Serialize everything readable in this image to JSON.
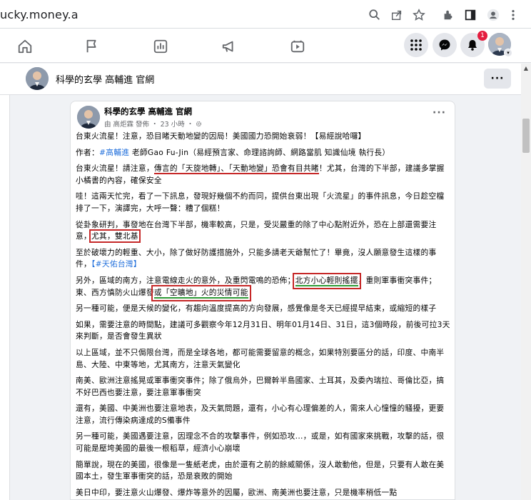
{
  "browser": {
    "url": "ucky.money.a",
    "icons": [
      "search-icon",
      "share-icon",
      "star-icon",
      "extensions-icon",
      "sidebar-icon",
      "profile-icon",
      "menu-icon"
    ]
  },
  "fb_nav": {
    "icons": [
      "home-icon",
      "flag-icon",
      "chart-icon",
      "megaphone-icon",
      "video-icon"
    ],
    "right_icons": [
      "apps-grid-icon",
      "messenger-icon",
      "bell-icon"
    ],
    "notification_count": "1"
  },
  "page_header": {
    "page_name": "科學的玄學 高輔進 官網",
    "more_label": "···"
  },
  "post": {
    "author": "科學的玄學 高輔進 官網",
    "meta": "由 高炬霖 發佈 ・ 23 小時 ・",
    "more_label": "···",
    "p1": "台東火流星！注意，恐目睹天動地變的因局！美國國力恐開始衰弱！【易經說哈囉】",
    "p2_prefix": "作者：",
    "p2_tag": "#高輔進",
    "p2_suffix": " 老師Gao Fu-Jin（易經預言家、命理諮詢師、網路當肌 知識仙境 執行長）",
    "p3_a": "台東火流星！請注意，",
    "p3_b": "傳言的「天旋地轉」、「天動地變」恐會有目共睹",
    "p3_c": "！尤其，台灣的下半部，建議多掌握小橘書的內容，確保安全",
    "p4": "哇！這兩天忙完，看了一下訊息，發現好幾個不約而同，提供台東出現「火流星」的事件訊息，今日趁空檔排了一下，演譯完，大呼一聲：糟了個糕！",
    "p5_a": "從卦象研判，事發地在台灣下半部，機率較高，只是，受災嚴重的除了中心點附近外，恐在上部還需要注意，",
    "p5_b": "尤其，雙北基",
    "p6_a": "至於破壞力的輕重、大小，除了做好防護措施外，只能多請老天爺幫忙了！畢竟，沒人願意發生這樣的事件，",
    "p6_tag": "【#天佑台灣】",
    "p7_a": "另外，區域的南方，注意電線走火的意外，及重閃電鳴的恐佈；",
    "p7_b": "北方小心輕則搖擺",
    "p7_c": "，重則軍事衝突事件；東、西方慎防火山爆發",
    "p7_d": "或「空曠地」火的災情可能",
    "p8": "另一種可能，便是天候的變化，有趨向溫度提高的方向發展，感覺像是冬天已經提早結束，或縮短的樣子",
    "p9": "如果，需要注意的時間點，建議可多觀察今年12月31日、明年01月14日、31日，這3個時段，前後可拉3天來判斷，是否會發生異狀",
    "p10": "以上區域，並不只侷限台灣，而是全球各地，都可能需要留意的概念，如果特別要區分的話，印度、中南半島、大陸、中東等地，尤其南方，注意天氣變化",
    "p11": "南美、歐洲注意搖晃或軍事衝突事件；除了俄烏外，巴爾幹半島國家、土耳其，及委內瑞拉、哥倫比亞，搞不好巴西也要注意，要注意軍事衝突",
    "p12": "還有，美國、中美洲也要注意地表，及天氣問題，還有，小心有心理偏差的人，需來人心憧憧的騷擾，更要注意，流行傳染病達成的S備事件",
    "p13": "另一種可能，美國遇要注意，因理念不合的攻擊事件，例如恐攻...，或是，如有國家來挑戰，攻擊的話，很可能是壓垮美國的最後一根稻草，經濟小心崩壞",
    "p14": "簡單說，現在的美國，很像是一隻紙老虎，由於還有之前的餘威關係，沒人敢動他，但是，只要有人敢在美國本土，發生軍事衝突的話，恐是衰敗的開始",
    "p15": "美日中印，要注意火山爆發、爆炸等意外的因屬，歐洲、南美洲也要注意，只是機率稍低一點"
  },
  "colors": {
    "hashtag": "#216fdb",
    "highlight_red": "#c62828",
    "highlight_green": "#2e9b37",
    "notification": "#e41e3f"
  }
}
